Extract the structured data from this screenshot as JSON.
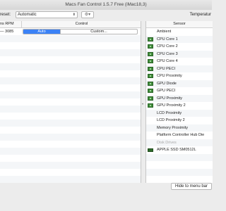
{
  "window": {
    "title": "Macs Fan Control 1.5.7 Free (iMac18,3)"
  },
  "toolbar": {
    "preset_label": "reset:",
    "preset_value": "Automatic",
    "gear_icon": "gear-icon",
    "temp_label": "Temperatur"
  },
  "fans": {
    "headers": {
      "rpm": "ns RPM",
      "control": "Control"
    },
    "rows": [
      {
        "rpm": "— 3085",
        "auto_label": "Auto",
        "custom_label": "Custom..."
      }
    ]
  },
  "sensors": {
    "header": "Sensor",
    "items": [
      {
        "name": "Ambient",
        "icon": "none"
      },
      {
        "name": "CPU Core 1",
        "icon": "chip-icon"
      },
      {
        "name": "CPU Core 2",
        "icon": "chip-icon"
      },
      {
        "name": "CPU Core 3",
        "icon": "chip-icon"
      },
      {
        "name": "CPU Core 4",
        "icon": "chip-icon"
      },
      {
        "name": "CPU PECI",
        "icon": "chip-icon"
      },
      {
        "name": "CPU Proximity",
        "icon": "chip-icon"
      },
      {
        "name": "GPU Diode",
        "icon": "chip-icon"
      },
      {
        "name": "GPU PECI",
        "icon": "chip-icon"
      },
      {
        "name": "GPU Proximity",
        "icon": "chip-icon"
      },
      {
        "name": "GPU Proximity 2",
        "icon": "chip-icon"
      },
      {
        "name": "LCD Proximity",
        "icon": "none"
      },
      {
        "name": "LCD Proximity 2",
        "icon": "none"
      },
      {
        "name": "Memory Proximity",
        "icon": "none"
      },
      {
        "name": "Platform Controller Hub Die",
        "icon": "none"
      },
      {
        "name": "Disk Drives",
        "icon": "none",
        "dim": true
      },
      {
        "name": "APPLE SSD SM0512L",
        "icon": "drive-icon"
      }
    ]
  },
  "bottom": {
    "hide_label": "Hide to menu bar"
  }
}
